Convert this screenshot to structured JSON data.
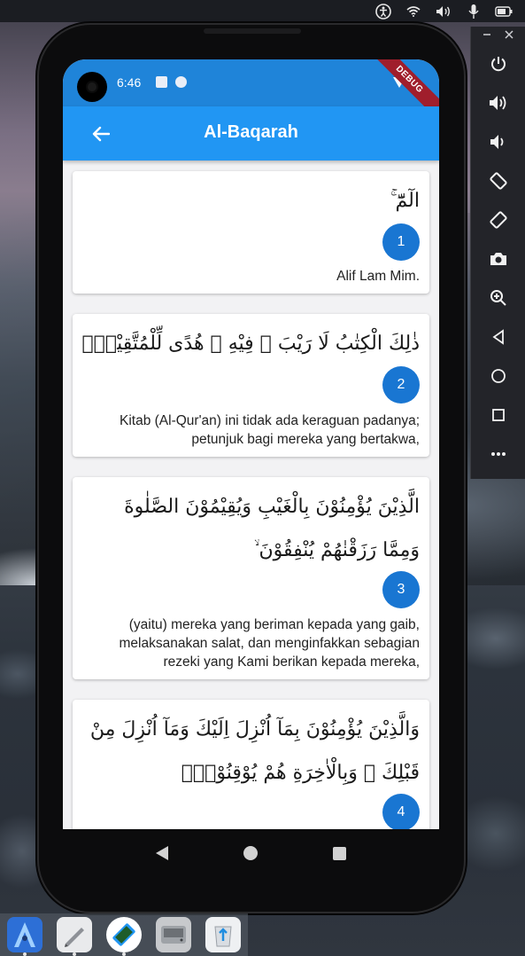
{
  "system_bar": {
    "icons": [
      "accessibility-icon",
      "wifi-icon",
      "volume-icon",
      "microphone-icon",
      "battery-icon"
    ]
  },
  "emulator_panel": {
    "top": [
      "minimize-icon",
      "close-icon"
    ],
    "buttons": [
      "power-icon",
      "volume-up-icon",
      "volume-down-icon",
      "rotate-left-icon",
      "rotate-right-icon",
      "camera-icon",
      "zoom-icon",
      "back-icon",
      "home-icon",
      "overview-icon",
      "more-icon"
    ]
  },
  "status_bar": {
    "time": "6:46",
    "debug_banner": "DEBUG"
  },
  "app_bar": {
    "title": "Al-Baqarah"
  },
  "verses": [
    {
      "number": "1",
      "arabic": [
        "الٓمّٓ ۚ"
      ],
      "translation": [
        "Alif Lam Mim."
      ]
    },
    {
      "number": "2",
      "arabic": [
        "ذٰلِكَ الْكِتٰبُ لَا رَيْبَ ۛ فِيْهِ ۛ هُدًى لِّلْمُتَّقِيْنَۙ"
      ],
      "translation": [
        "Kitab (Al-Qur'an) ini tidak ada keraguan padanya;",
        "petunjuk bagi mereka yang bertakwa,"
      ]
    },
    {
      "number": "3",
      "arabic": [
        "الَّذِيْنَ يُؤْمِنُوْنَ بِالْغَيْبِ وَيُقِيْمُوْنَ الصَّلٰوةَ",
        "وَمِمَّا رَزَقْنٰهُمْ يُنْفِقُوْنَ ۙ"
      ],
      "translation": [
        "(yaitu) mereka yang beriman kepada yang gaib,",
        "melaksanakan salat, dan menginfakkan sebagian",
        "rezeki yang Kami berikan kepada mereka,"
      ]
    },
    {
      "number": "4",
      "arabic": [
        "وَالَّذِيْنَ يُؤْمِنُوْنَ بِمَآ اُنْزِلَ اِلَيْكَ وَمَآ اُنْزِلَ مِنْ",
        "قَبْلِكَ ۚ وَبِالْاٰخِرَةِ هُمْ يُوْقِنُوْنَۗ"
      ],
      "translation": []
    }
  ],
  "dock": {
    "apps": [
      "android-studio-icon",
      "text-editor-icon",
      "emulator-icon",
      "disk-icon",
      "recycle-bin-icon"
    ]
  }
}
